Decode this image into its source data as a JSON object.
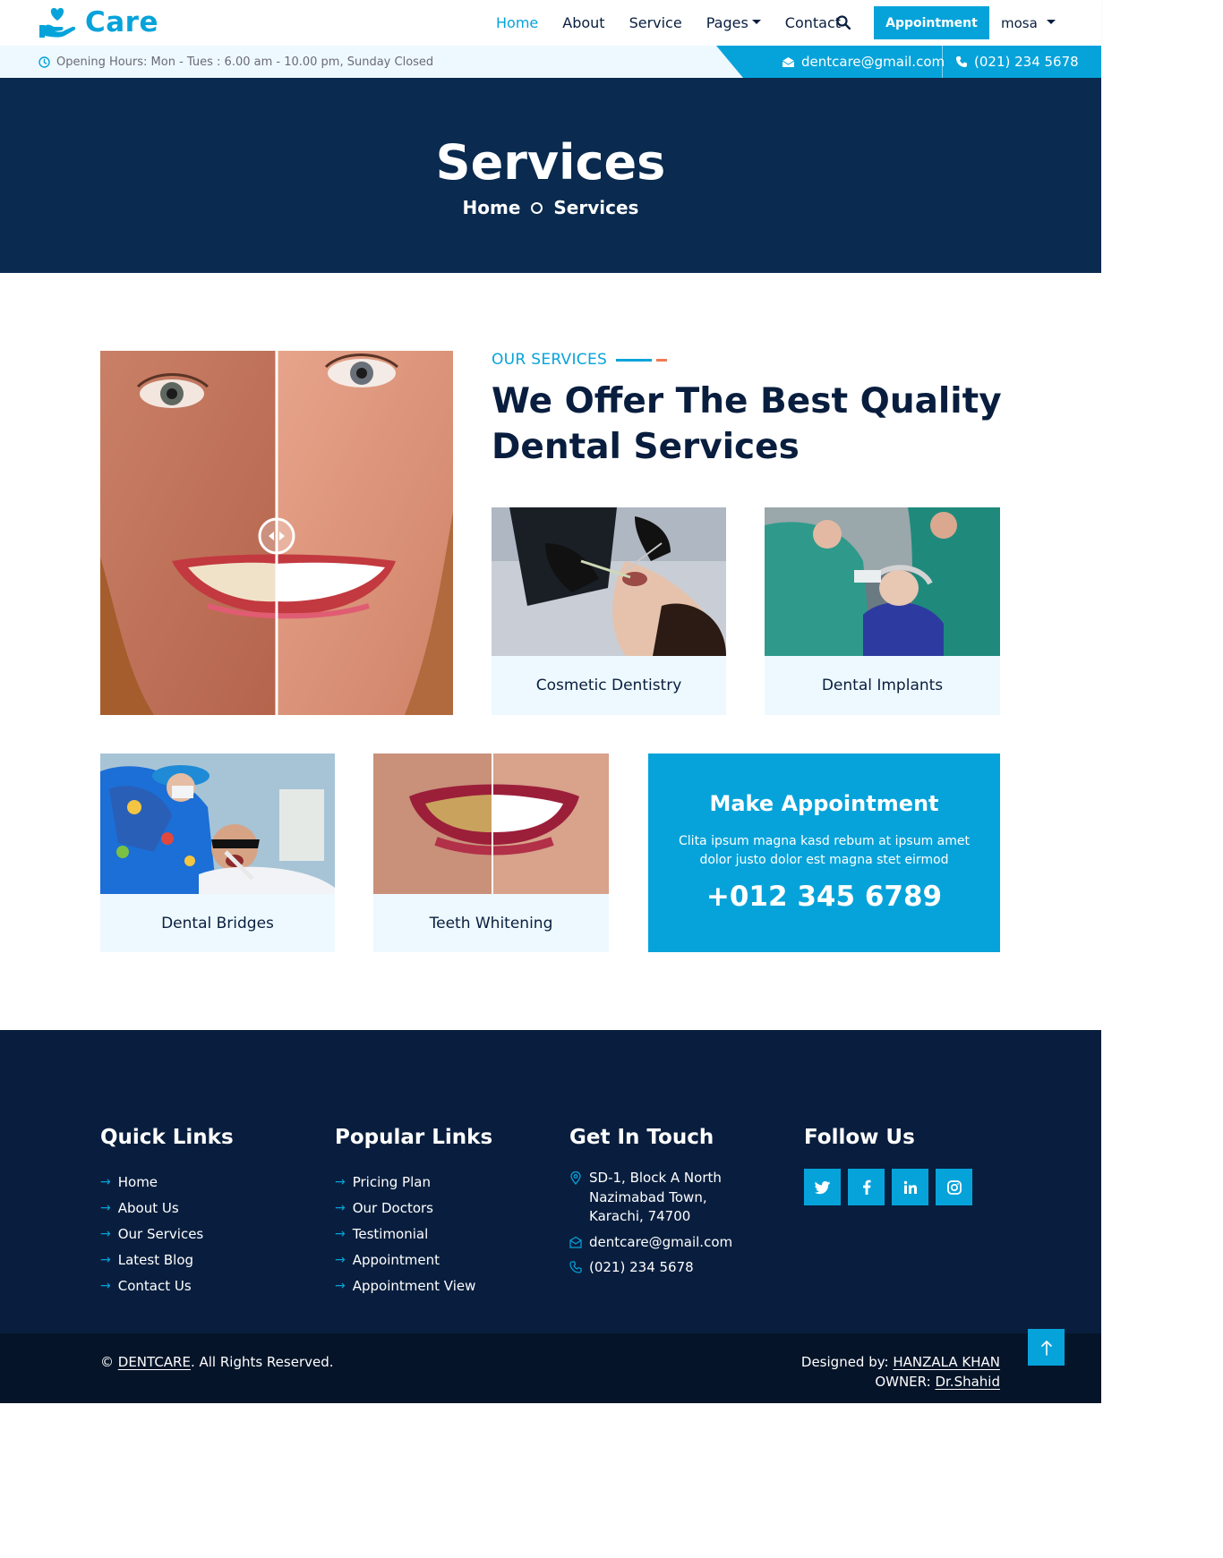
{
  "brand": {
    "name": "Care"
  },
  "nav": {
    "items": [
      {
        "label": "Home",
        "active": true
      },
      {
        "label": "About"
      },
      {
        "label": "Service"
      },
      {
        "label": "Pages",
        "dropdown": true
      },
      {
        "label": "Contact"
      }
    ],
    "appointment_label": "Appointment",
    "user_label": "mosa"
  },
  "topbar": {
    "hours": "Opening Hours: Mon - Tues : 6.00 am - 10.00 pm, Sunday Closed",
    "email": "dentcare@gmail.com",
    "phone": "(021) 234 5678"
  },
  "hero": {
    "title": "Services",
    "breadcrumb": [
      "Home",
      "Services"
    ]
  },
  "services": {
    "label": "OUR SERVICES",
    "heading": "We Offer The Best Quality Dental Services",
    "cards": [
      {
        "title": "Cosmetic Dentistry"
      },
      {
        "title": "Dental Implants"
      },
      {
        "title": "Dental Bridges"
      },
      {
        "title": "Teeth Whitening"
      }
    ]
  },
  "appointment_box": {
    "title": "Make Appointment",
    "text": "Clita ipsum magna kasd rebum at ipsum amet dolor justo dolor est magna stet eirmod",
    "phone": "+012 345 6789"
  },
  "footer": {
    "quick_links": {
      "title": "Quick Links",
      "items": [
        "Home",
        "About Us",
        "Our Services",
        "Latest Blog",
        "Contact Us"
      ]
    },
    "popular_links": {
      "title": "Popular Links",
      "items": [
        "Pricing Plan",
        "Our Doctors",
        "Testimonial",
        "Appointment",
        "Appointment View"
      ]
    },
    "get_in_touch": {
      "title": "Get In Touch",
      "address": "SD-1, Block A North Nazimabad Town, Karachi, 74700",
      "email": "dentcare@gmail.com",
      "phone": "(021) 234 5678"
    },
    "follow_us": {
      "title": "Follow Us",
      "icons": [
        "twitter-icon",
        "facebook-icon",
        "linkedin-icon",
        "instagram-icon"
      ]
    }
  },
  "copyright": {
    "symbol": "©",
    "brand_link": "DENTCARE",
    "rights": ". All Rights Reserved.",
    "designed_by_label": "Designed by:",
    "designer": "HANZALA KHAN",
    "owner_label": "OWNER:",
    "owner": "Dr.Shahid"
  },
  "colors": {
    "primary": "#06a3da",
    "dark": "#091e3e",
    "hero_bg": "#0a2a4f",
    "light_bg": "#eef9ff",
    "accent": "#ef7a55"
  }
}
